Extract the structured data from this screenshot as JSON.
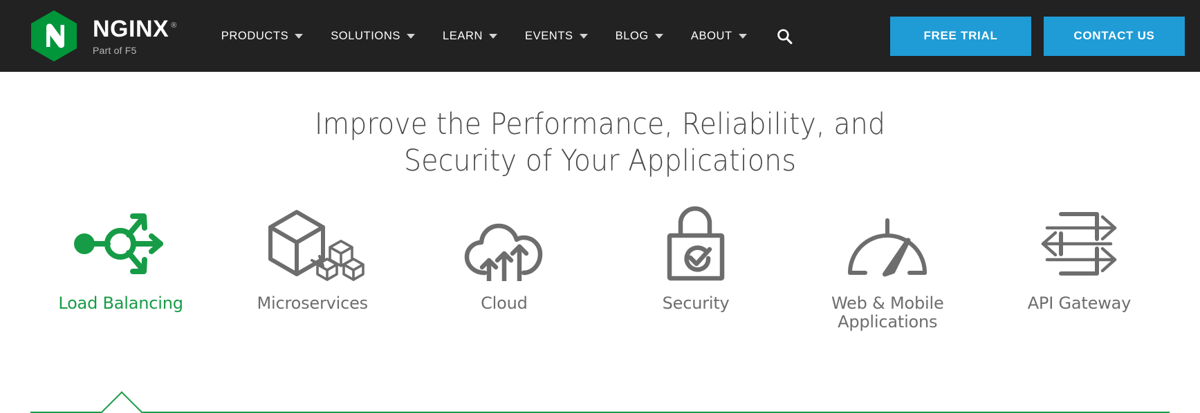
{
  "header": {
    "brand": {
      "logo_icon": "nginx-hexagon-n-logo",
      "name": "NGINX",
      "registered_mark": "®",
      "subtitle": "Part of F5",
      "logo_color": "#009639"
    },
    "nav": [
      {
        "label": "PRODUCTS",
        "has_dropdown": true
      },
      {
        "label": "SOLUTIONS",
        "has_dropdown": true
      },
      {
        "label": "LEARN",
        "has_dropdown": true
      },
      {
        "label": "EVENTS",
        "has_dropdown": true
      },
      {
        "label": "BLOG",
        "has_dropdown": true
      },
      {
        "label": "ABOUT",
        "has_dropdown": true
      }
    ],
    "search_icon": "search-icon",
    "actions": [
      {
        "label": "FREE TRIAL",
        "name": "free-trial-button"
      },
      {
        "label": "CONTACT US",
        "name": "contact-us-button"
      }
    ],
    "background": "#222222",
    "button_color": "#1f9bd6"
  },
  "hero": {
    "headline_line1": "Improve the Performance, Reliability, and",
    "headline_line2": "Security of Your Applications",
    "headline_color": "#4a4a4a",
    "accent_color": "#169c46",
    "tabs": [
      {
        "label": "Load Balancing",
        "icon": "load-balancing-icon",
        "active": true
      },
      {
        "label": "Microservices",
        "icon": "microservices-cubes-icon",
        "active": false
      },
      {
        "label": "Cloud",
        "icon": "cloud-arrows-icon",
        "active": false
      },
      {
        "label": "Security",
        "icon": "padlock-check-icon",
        "active": false
      },
      {
        "label": "Web & Mobile Applications",
        "icon": "speedometer-gauge-icon",
        "active": false
      },
      {
        "label": "API Gateway",
        "icon": "api-gateway-arrows-icon",
        "active": false
      }
    ]
  }
}
